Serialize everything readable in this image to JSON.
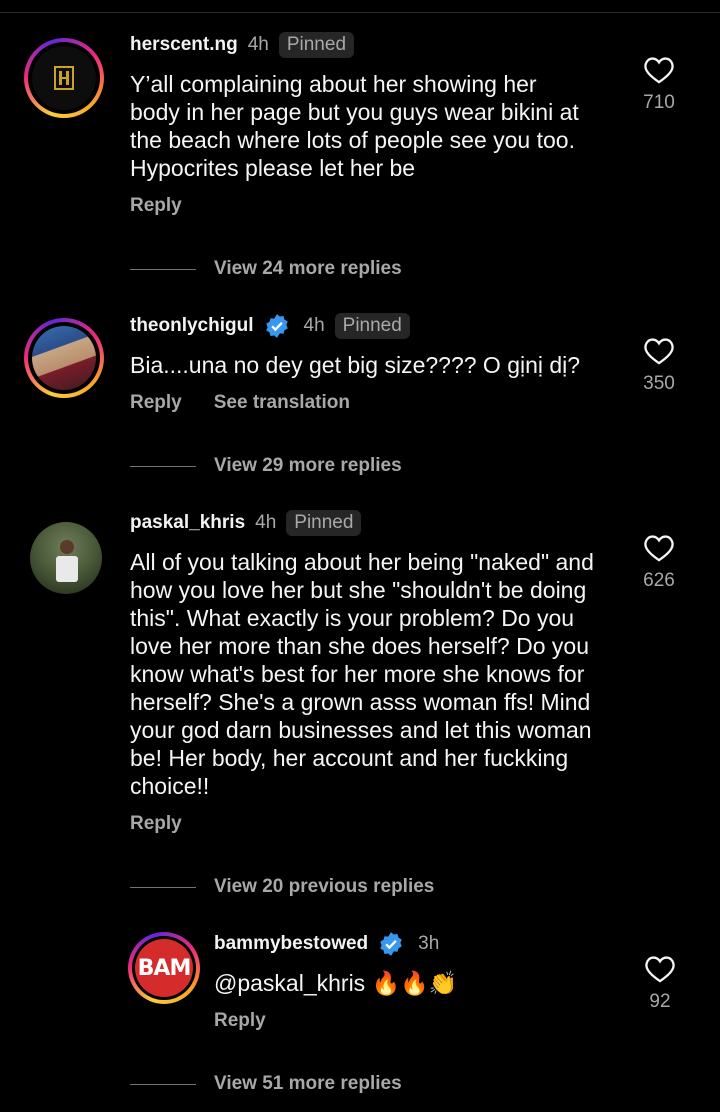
{
  "comments": [
    {
      "username": "herscent.ng",
      "time": "4h",
      "badge": "Pinned",
      "text": "Y’all complaining about her showing her\nbody in her page but you guys wear bikini at\nthe beach where lots of people see you too.\nHypocrites please let her be",
      "reply": "Reply",
      "likes": "710",
      "view_replies": "View 24 more replies"
    },
    {
      "username": "theonlychigul",
      "time": "4h",
      "badge": "Pinned",
      "text": "Bia....una no dey get big size???? O gịnị dị?",
      "reply": "Reply",
      "translate": "See translation",
      "likes": "350",
      "view_replies": "View 29 more replies"
    },
    {
      "username": "paskal_khris",
      "time": "4h",
      "badge": "Pinned",
      "text": "All of you talking about her being \"naked\" and\nhow you love her but she \"shouldn't be doing\nthis\". What exactly is your problem? Do you\nlove her more than she does herself? Do you\nknow what's best for her more she knows for\nherself? She's a grown asss woman ffs! Mind\nyour god darn businesses and let this woman\nbe! Her body, her account and her fuckking\nchoice!!",
      "reply": "Reply",
      "likes": "626",
      "view_replies": "View 20 previous replies"
    },
    {
      "username": "bammybestowed",
      "time": "3h",
      "text": "@paskal_khris 🔥🔥👏",
      "reply": "Reply",
      "likes": "92",
      "view_replies": "View 51 more replies",
      "avatar_text": "BAM"
    }
  ],
  "icons": {
    "like": "heart-outline-icon",
    "verified": "verified-badge-icon"
  },
  "colors": {
    "background": "#000000",
    "secondary_text": "#a8a8a8",
    "verified": "#3897f0",
    "pinned_bg": "#262626"
  }
}
